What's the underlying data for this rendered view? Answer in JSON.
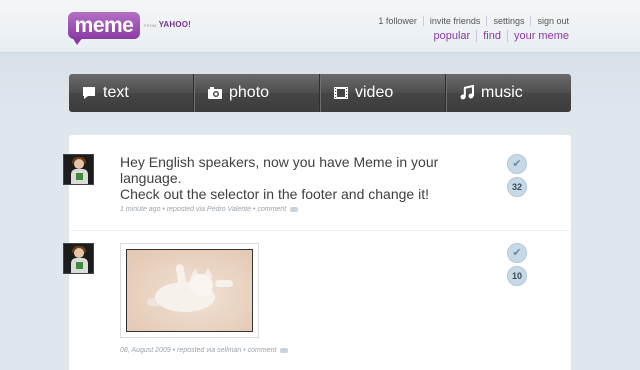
{
  "header": {
    "logo_text": "meme",
    "from_label": "FROM",
    "yahoo_label": "YAHOO!",
    "top_links": [
      "1 follower",
      "invite friends",
      "settings",
      "sign out"
    ],
    "main_nav": [
      "popular",
      "find",
      "your meme"
    ]
  },
  "post_types": [
    {
      "label": "text",
      "icon": "speech-bubble-icon"
    },
    {
      "label": "photo",
      "icon": "camera-icon"
    },
    {
      "label": "video",
      "icon": "film-icon"
    },
    {
      "label": "music",
      "icon": "music-note-icon"
    }
  ],
  "posts": [
    {
      "text_line1": "Hey English speakers, now you have Meme in your language.",
      "text_line2": "Check out the selector in the footer and change it!",
      "meta_time": "1 minute ago",
      "meta_via": "reposted via Pedro Valente",
      "meta_comment": "comment",
      "repost_count": "32"
    },
    {
      "meta_time": "08, August 2009",
      "meta_via": "reposted via sellman",
      "meta_comment": "comment",
      "repost_count": "10"
    }
  ],
  "colors": {
    "brand_purple": "#8a3ba3",
    "postbar_dark": "#454545",
    "badge_blue": "#c7d9e6"
  }
}
